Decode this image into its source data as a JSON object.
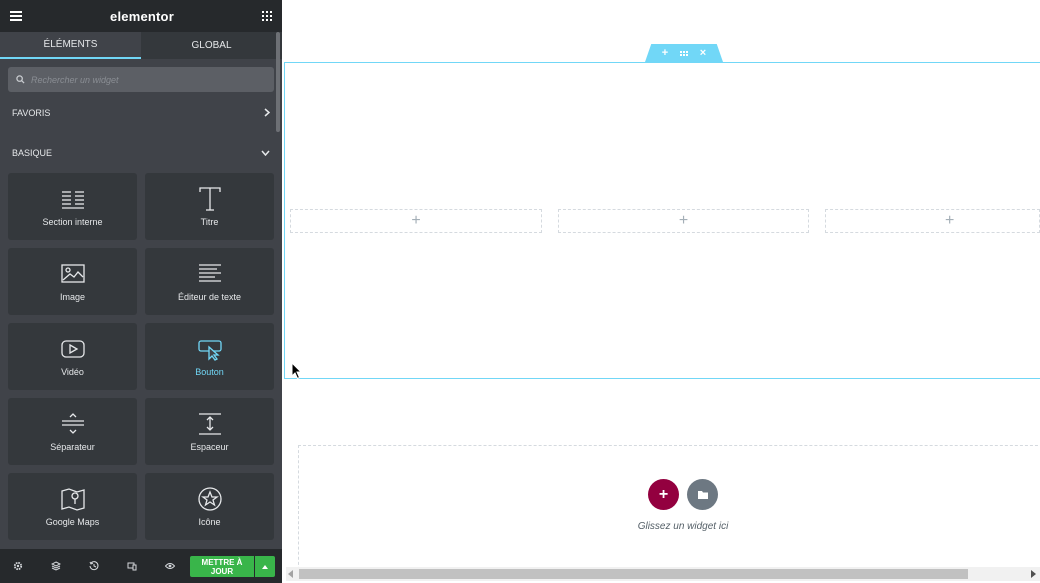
{
  "panel": {
    "brand": "elementor",
    "tabs": [
      {
        "label": "ÉLÉMENTS",
        "active": true
      },
      {
        "label": "GLOBAL",
        "active": false
      }
    ],
    "search": {
      "placeholder": "Rechercher un widget",
      "value": ""
    },
    "categories": {
      "favoris": "FAVORIS",
      "basique": "BASIQUE"
    },
    "widgets": [
      {
        "label": "Section interne",
        "icon": "inner-section-icon"
      },
      {
        "label": "Titre",
        "icon": "heading-icon"
      },
      {
        "label": "Image",
        "icon": "image-icon"
      },
      {
        "label": "Éditeur de texte",
        "icon": "text-editor-icon"
      },
      {
        "label": "Vidéo",
        "icon": "video-icon"
      },
      {
        "label": "Bouton",
        "icon": "button-icon",
        "highlighted": true
      },
      {
        "label": "Séparateur",
        "icon": "divider-icon"
      },
      {
        "label": "Espaceur",
        "icon": "spacer-icon"
      },
      {
        "label": "Google Maps",
        "icon": "google-maps-icon"
      },
      {
        "label": "Icône",
        "icon": "star-icon"
      }
    ],
    "footer": {
      "publish_line1": "METTRE À",
      "publish_line2": "JOUR"
    }
  },
  "canvas": {
    "drop_text": "Glissez un widget ici"
  },
  "colors": {
    "panel_bg": "#404349",
    "header_bg": "#26292c",
    "accent": "#71d7f7",
    "publish": "#39b54a",
    "add_section": "#93003f",
    "add_template": "#6d7882"
  }
}
